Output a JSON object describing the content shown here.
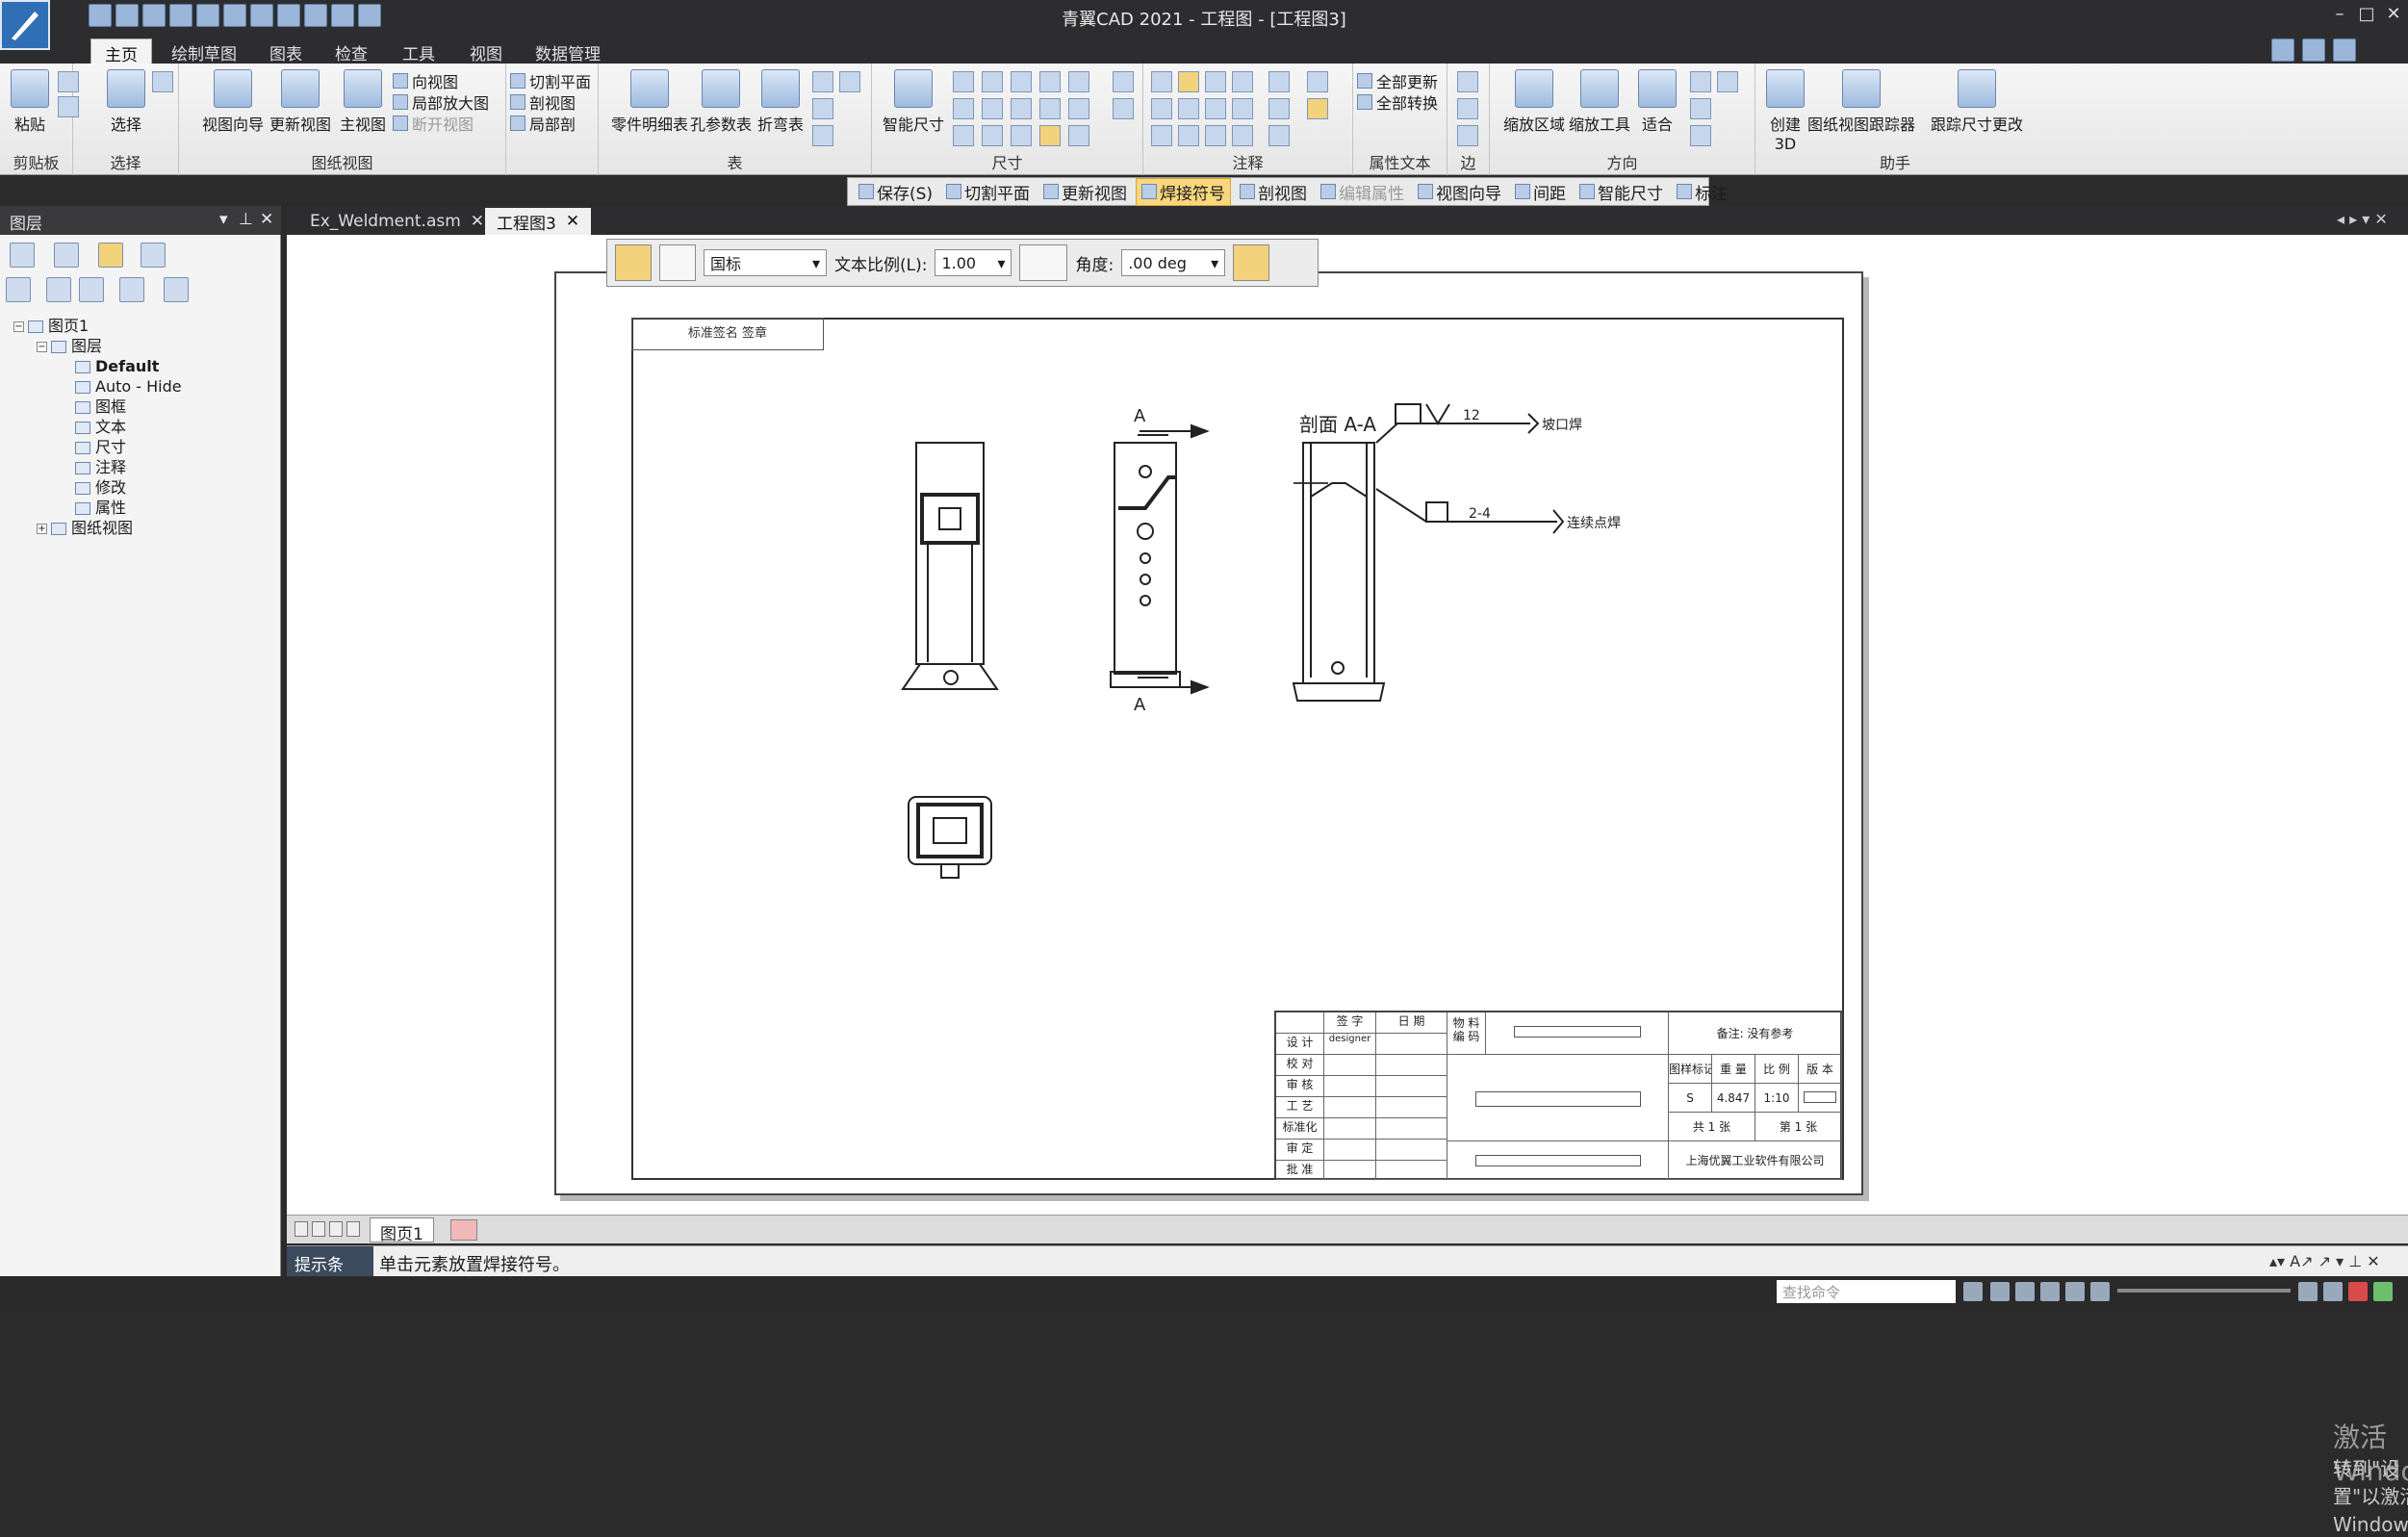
{
  "window": {
    "title": "青翼CAD 2021 - 工程图 - [工程图3]"
  },
  "ribbon_tabs": [
    "主页",
    "绘制草图",
    "图表",
    "检查",
    "工具",
    "视图",
    "数据管理"
  ],
  "ribbon": {
    "clipboard": {
      "label": "剪贴板",
      "paste": "粘贴"
    },
    "select": {
      "label": "选择",
      "select": "选择"
    },
    "view_wizard": "视图向导",
    "update_view": "更新视图",
    "drawing_views": {
      "label": "图纸视图",
      "main_view": "主视图",
      "direction_view": "向视图",
      "detail_view": "局部放大图",
      "break_view": "断开视图",
      "cut_plane": "切割平面",
      "section_view": "剖视图",
      "partial_section": "局部剖"
    },
    "tables": {
      "label": "表",
      "parts_list": "零件明细表",
      "hole_table": "孔参数表",
      "bend_table": "折弯表"
    },
    "dimension": {
      "label": "尺寸",
      "smart_dim": "智能尺寸"
    },
    "annotation": {
      "label": "注释"
    },
    "attribute_text": {
      "label": "属性文本",
      "update_all": "全部更新",
      "convert_all": "全部转换"
    },
    "edge": {
      "label": "边"
    },
    "direction": {
      "label": "方向",
      "zoom_area": "缩放区域",
      "zoom_tool": "缩放工具",
      "fit": "适合"
    },
    "assistant": {
      "label": "助手",
      "create_3d": "创建3D",
      "view_tracker": "图纸视图跟踪器",
      "track_dim": "跟踪尺寸更改"
    }
  },
  "command_bar": [
    "保存(S)",
    "切割平面",
    "更新视图",
    "焊接符号",
    "剖视图",
    "编辑属性",
    "视图向导",
    "间距",
    "智能尺寸",
    "标注"
  ],
  "left_panel": {
    "title": "图层",
    "tree": {
      "page": "图页1",
      "layers": "图层",
      "items": [
        "Default",
        "Auto - Hide",
        "图框",
        "文本",
        "尺寸",
        "注释",
        "修改",
        "属性"
      ],
      "drawing_views": "图纸视图"
    }
  },
  "doc_tabs": [
    {
      "label": "Ex_Weldment.asm",
      "active": false
    },
    {
      "label": "工程图3",
      "active": true
    }
  ],
  "weld_toolbar": {
    "standard": "国标",
    "text_scale_label": "文本比例(L):",
    "text_scale": "1.00",
    "angle_label": "角度:",
    "angle": ".00 deg"
  },
  "drawing": {
    "stamp": "标准签名 签章",
    "section_label": "剖面 A-A",
    "arrow_a": "A",
    "weld1_size": "12",
    "weld1_note": "坡口焊",
    "weld2_size": "2-4",
    "weld2_note": "连续点焊"
  },
  "titleblock": {
    "sign": "签 字",
    "date": "日 期",
    "rows": [
      "设 计",
      "校 对",
      "审 核",
      "工 艺",
      "标准化",
      "审 定",
      "批 准"
    ],
    "designer": "designer",
    "material_code": "物 料 编 码",
    "remark": "备注: 没有参考",
    "heads": [
      "图样标记",
      "重 量",
      "比 例",
      "版 本"
    ],
    "mark": "S",
    "weight": "4.847",
    "scale": "1:10",
    "total": "共 1 张",
    "sheet": "第 1 张",
    "company": "上海优翼工业软件有限公司"
  },
  "page_tabs": [
    "图页1"
  ],
  "cmdline": {
    "label": "提示条",
    "text": "单击元素放置焊接符号。"
  },
  "statusbar": {
    "find_placeholder": "查找命令"
  },
  "watermark": {
    "line1": "激活 Windows",
    "line2": "转到\"设置\"以激活 Windows。"
  }
}
